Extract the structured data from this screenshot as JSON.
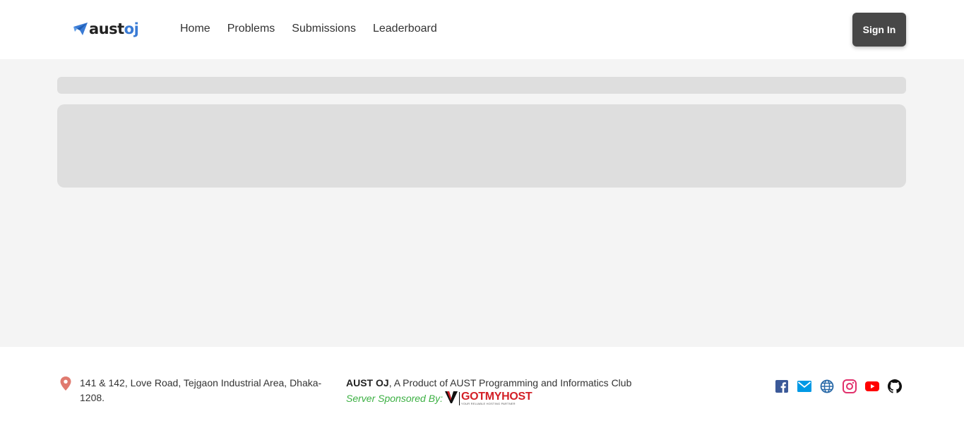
{
  "brand": {
    "logo_prefix": "aust",
    "logo_suffix": "oj",
    "accent_color": "#3a7bd5"
  },
  "nav": {
    "items": [
      {
        "label": "Home"
      },
      {
        "label": "Problems"
      },
      {
        "label": "Submissions"
      },
      {
        "label": "Leaderboard"
      }
    ],
    "signin_label": "Sign In"
  },
  "main": {
    "state": "loading"
  },
  "footer": {
    "address": "141 & 142, Love Road, Tejgaon Industrial Area, Dhaka-1208.",
    "product_name": "AUST OJ",
    "product_tagline": ", A Product of AUST Programming and Informatics Club",
    "sponsor_label": "Server Sponsored By:",
    "sponsor_name": "GOTMYHOST",
    "sponsor_tagline": "YOUR RELIABLE HOSTING PARTNER",
    "social_icons": [
      "facebook-icon",
      "email-icon",
      "website-icon",
      "instagram-icon",
      "youtube-icon",
      "github-icon"
    ],
    "colors": {
      "facebook": "#3b5998",
      "email": "#0099e5",
      "website": "#2a6aa8",
      "instagram": "#e1306c",
      "youtube": "#ff0000",
      "github": "#111111",
      "pin": "#e07a6f"
    }
  }
}
